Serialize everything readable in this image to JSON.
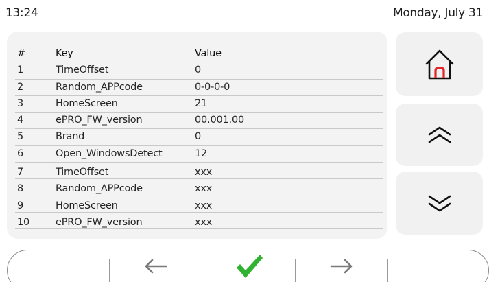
{
  "status": {
    "time": "13:24",
    "date": "Monday, July 31"
  },
  "table": {
    "headers": {
      "index": "#",
      "key": "Key",
      "value": "Value"
    },
    "rows": [
      {
        "index": "1",
        "key": "TimeOffset",
        "value": "0"
      },
      {
        "index": "2",
        "key": "Random_APPcode",
        "value": "0-0-0-0"
      },
      {
        "index": "3",
        "key": "HomeScreen",
        "value": "21"
      },
      {
        "index": "4",
        "key": "ePRO_FW_version",
        "value": "00.001.00"
      },
      {
        "index": "5",
        "key": "Brand",
        "value": "0"
      },
      {
        "index": "6",
        "key": "Open_WindowsDetect",
        "value": "12"
      },
      {
        "index": "7",
        "key": "TimeOffset",
        "value": "xxx"
      },
      {
        "index": "8",
        "key": "Random_APPcode",
        "value": "xxx"
      },
      {
        "index": "9",
        "key": "HomeScreen",
        "value": "xxx"
      },
      {
        "index": "10",
        "key": "ePRO_FW_version",
        "value": "xxx"
      }
    ]
  },
  "side_buttons": {
    "home_icon": "home-icon",
    "up_icon": "double-chevron-up-icon",
    "down_icon": "double-chevron-down-icon"
  },
  "bottom_bar": {
    "back_icon": "arrow-left-icon",
    "confirm_icon": "checkmark-icon",
    "forward_icon": "arrow-right-icon"
  },
  "colors": {
    "accent_red": "#e3242b",
    "confirm_green": "#2fb22f",
    "panel_bg": "#f3f3f3",
    "icon_gray": "#7a7a7a"
  }
}
